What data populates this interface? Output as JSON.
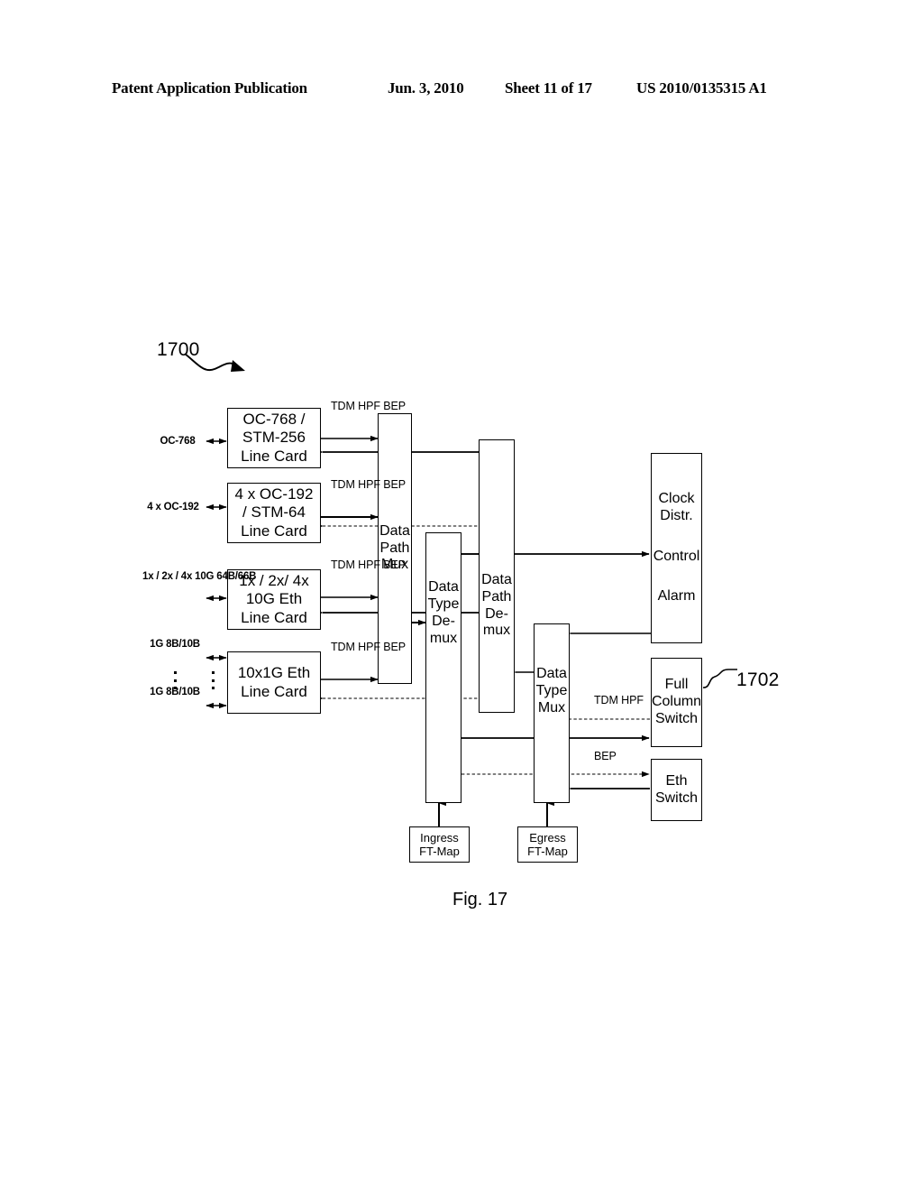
{
  "header": {
    "publication": "Patent Application Publication",
    "date": "Jun. 3, 2010",
    "sheet": "Sheet 11 of 17",
    "patent_number": "US 2010/0135315 A1"
  },
  "figure": {
    "caption": "Fig. 17",
    "reference_numeral": "1700",
    "callout_numeral": "1702"
  },
  "ports": [
    {
      "id": "port-oc768",
      "lines": [
        "OC-768"
      ]
    },
    {
      "id": "port-oc192",
      "lines": [
        "4 x OC-192"
      ]
    },
    {
      "id": "port-10g",
      "lines": [
        "1x / 2x / 4x",
        "10G",
        "64B/66B"
      ]
    },
    {
      "id": "port-1g-top",
      "lines": [
        "1G",
        "8B/10B"
      ]
    },
    {
      "id": "port-1g-bot",
      "lines": [
        "1G",
        "8B/10B"
      ]
    }
  ],
  "line_cards": [
    {
      "id": "linecard-oc768",
      "lines": [
        "OC-768 /",
        "STM-256",
        "Line Card"
      ]
    },
    {
      "id": "linecard-oc192",
      "lines": [
        "4 x OC-192",
        "/ STM-64",
        "Line Card"
      ]
    },
    {
      "id": "linecard-10g-eth",
      "lines": [
        "1x / 2x/ 4x",
        "10G Eth",
        "Line Card"
      ]
    },
    {
      "id": "linecard-1g-eth",
      "lines": [
        "10x1G Eth",
        "Line Card"
      ]
    }
  ],
  "signal_groups": [
    {
      "id": "sig-group-1",
      "lines": [
        "TDM",
        "HPF",
        "BEP"
      ]
    },
    {
      "id": "sig-group-2",
      "lines": [
        "TDM",
        "HPF",
        "BEP"
      ]
    },
    {
      "id": "sig-group-3",
      "lines": [
        "TDM",
        "HPF",
        "BEP"
      ]
    },
    {
      "id": "sig-group-4",
      "lines": [
        "TDM",
        "HPF",
        "BEP"
      ]
    }
  ],
  "switch_signals": [
    {
      "id": "sig-fullcolumn",
      "lines": [
        "TDM",
        "HPF"
      ]
    },
    {
      "id": "sig-eth",
      "lines": [
        "BEP"
      ]
    }
  ],
  "blocks": {
    "data_path_mux": {
      "lines": [
        "Data",
        "Path",
        "Mux"
      ]
    },
    "data_type_demux": {
      "lines": [
        "Data",
        "Type",
        "De-",
        "mux"
      ]
    },
    "data_path_demux": {
      "lines": [
        "Data",
        "Path",
        "De-",
        "mux"
      ]
    },
    "data_type_mux": {
      "lines": [
        "Data",
        "Type",
        "Mux"
      ]
    },
    "clock_control": {
      "lines": [
        "Clock",
        "Distr.",
        "Control",
        "Alarm"
      ]
    },
    "full_column_switch": {
      "lines": [
        "Full",
        "Column",
        "Switch"
      ]
    },
    "eth_switch": {
      "lines": [
        "Eth",
        "Switch"
      ]
    },
    "ingress_ftmap": {
      "lines": [
        "Ingress",
        "FT-Map"
      ]
    },
    "egress_ftmap": {
      "lines": [
        "Egress",
        "FT-Map"
      ]
    }
  },
  "colors": {
    "ink": "#000000",
    "paper": "#ffffff"
  }
}
